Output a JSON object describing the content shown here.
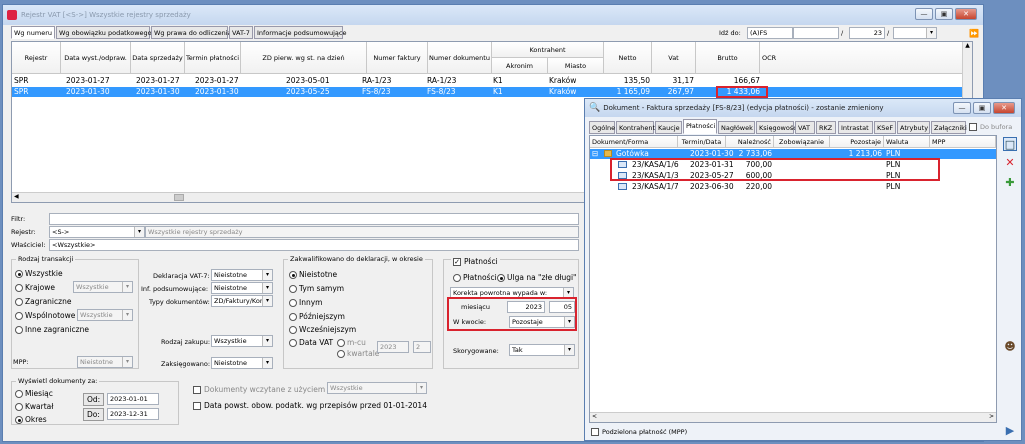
{
  "main": {
    "title": "Rejestr VAT  [<S->]  Wszystkie rejestry sprzedaży",
    "tabs": [
      "Wg numeru",
      "Wg obowiązku podatkowego",
      "Wg prawa do odliczenia",
      "VAT-7",
      "Informacje podsumowujące"
    ],
    "idz_do_label": "Idź do:",
    "idz_do_value": "(A)FS",
    "spin_value": "23",
    "columns": [
      "Rejestr",
      "Data wyst./odpraw.",
      "Data sprzedaży",
      "Termin płatności",
      "ZD pierw. wg st. na dzień",
      "Numer faktury",
      "Numer dokumentu",
      "Akronim",
      "Miasto",
      "Netto",
      "Vat",
      "Brutto",
      "OCR"
    ],
    "kontrahent_label": "Kontrahent",
    "rows": [
      [
        "SPR",
        "2023-01-27",
        "2023-01-27",
        "2023-01-27",
        "2023-05-01",
        "RA-1/23",
        "RA-1/23",
        "K1",
        "Kraków",
        "135,50",
        "31,17",
        "166,67",
        ""
      ],
      [
        "SPR",
        "2023-01-30",
        "2023-01-30",
        "2023-01-30",
        "2023-05-25",
        "FS-8/23",
        "FS-8/23",
        "K1",
        "Kraków",
        "1 165,09",
        "267,97",
        "1 433,06",
        ""
      ]
    ],
    "filtr_label": "Filtr:",
    "rejestr_label": "Rejestr:",
    "rejestr_value": "<S->",
    "rejestr_desc": "Wszystkie rejestry sprzedaży",
    "wlasciciel_label": "Właściciel:",
    "wlasciciel_value": "<Wszystkie>",
    "rodzaj_group": "Rodzaj transakcji",
    "rodzaj_opts": [
      "Wszystkie",
      "Krajowe",
      "Zagraniczne",
      "Wspólnotowe",
      "Inne zagraniczne"
    ],
    "krajowe_combo": "Wszystkie",
    "wspolnotowe_combo": "Wszystkie",
    "mpp_label": "MPP:",
    "mpp_value": "Nieistotne",
    "deklaracja_label": "Deklaracja VAT-7:",
    "deklaracja_value": "Nieistotne",
    "inf_label": "Inf. podsumowujące:",
    "inf_value": "Nieistotne",
    "typy_label": "Typy dokumentów:",
    "typy_value": "ZD/Faktury/Kor",
    "rodzaj_zakupu_label": "Rodzaj zakupu:",
    "rodzaj_zakupu_value": "Wszystkie",
    "zaksiegowano_label": "Zaksięgowano:",
    "zaksiegowano_value": "Nieistotne",
    "zakwal_group": "Zakwalifikowano do deklaracji, w okresie",
    "zakwal_opts": [
      "Nieistotne",
      "Tym samym",
      "Innym",
      "Późniejszym",
      "Wcześniejszym",
      "Data VAT"
    ],
    "mcu_label": "m-cu",
    "kwartale_label": "kwartale",
    "vat_year": "2023",
    "vat_q": "2",
    "platnosci_check": "Płatności",
    "plat_opt1": "Płatności",
    "plat_opt2": "Ulga na \"złe długi\"",
    "korekta_value": "Korekta powrotna wypada w:",
    "miesiacu_label": "miesiącu",
    "miesiac_year": "2023",
    "miesiac_month": "05",
    "kwocie_label": "W kwocie:",
    "kwocie_value": "Pozostaje",
    "skorygowane_label": "Skorygowane:",
    "skorygowane_value": "Tak",
    "wyswietl_group": "Wyświetl dokumenty za:",
    "wyswietl_opts": [
      "Miesiąc",
      "Kwartał",
      "Okres"
    ],
    "od_label": "Od:",
    "od_value": "2023-01-01",
    "do_label": "Do:",
    "do_value": "2023-12-31",
    "ocr_check": "Dokumenty wczytane z użyciem OCR",
    "ocr_combo": "Wszystkie",
    "data_powst_check": "Data powst. obow. podatk. wg przepisów przed 01-01-2014"
  },
  "dialog": {
    "title": "Dokument - Faktura sprzedaży [FS-8/23] (edycja płatności) - zostanie zmieniony",
    "tabs": [
      "Ogólne",
      "Kontrahent",
      "Kaucje",
      "Płatności",
      "Nagłówek",
      "Księgowość",
      "VAT",
      "RKZ",
      "Intrastat",
      "KSeF",
      "Atrybuty",
      "Załączniki"
    ],
    "do_bufora": "Do bufora",
    "columns": [
      "Dokument/Forma",
      "Termin/Data",
      "Należność",
      "Zobowiązanie",
      "Pozostaje",
      "Waluta",
      "MPP"
    ],
    "rows": [
      [
        "Gotówka",
        "2023-01-30",
        "2 733,06",
        "",
        "1 213,06",
        "PLN",
        ""
      ],
      [
        "23/KASA/1/6",
        "2023-01-31",
        "700,00",
        "",
        "",
        "PLN",
        ""
      ],
      [
        "23/KASA/1/3",
        "2023-05-27",
        "600,00",
        "",
        "",
        "PLN",
        ""
      ],
      [
        "23/KASA/1/7",
        "2023-06-30",
        "220,00",
        "",
        "",
        "PLN",
        ""
      ]
    ],
    "podzielona_label": "Podzielona płatność (MPP)"
  }
}
